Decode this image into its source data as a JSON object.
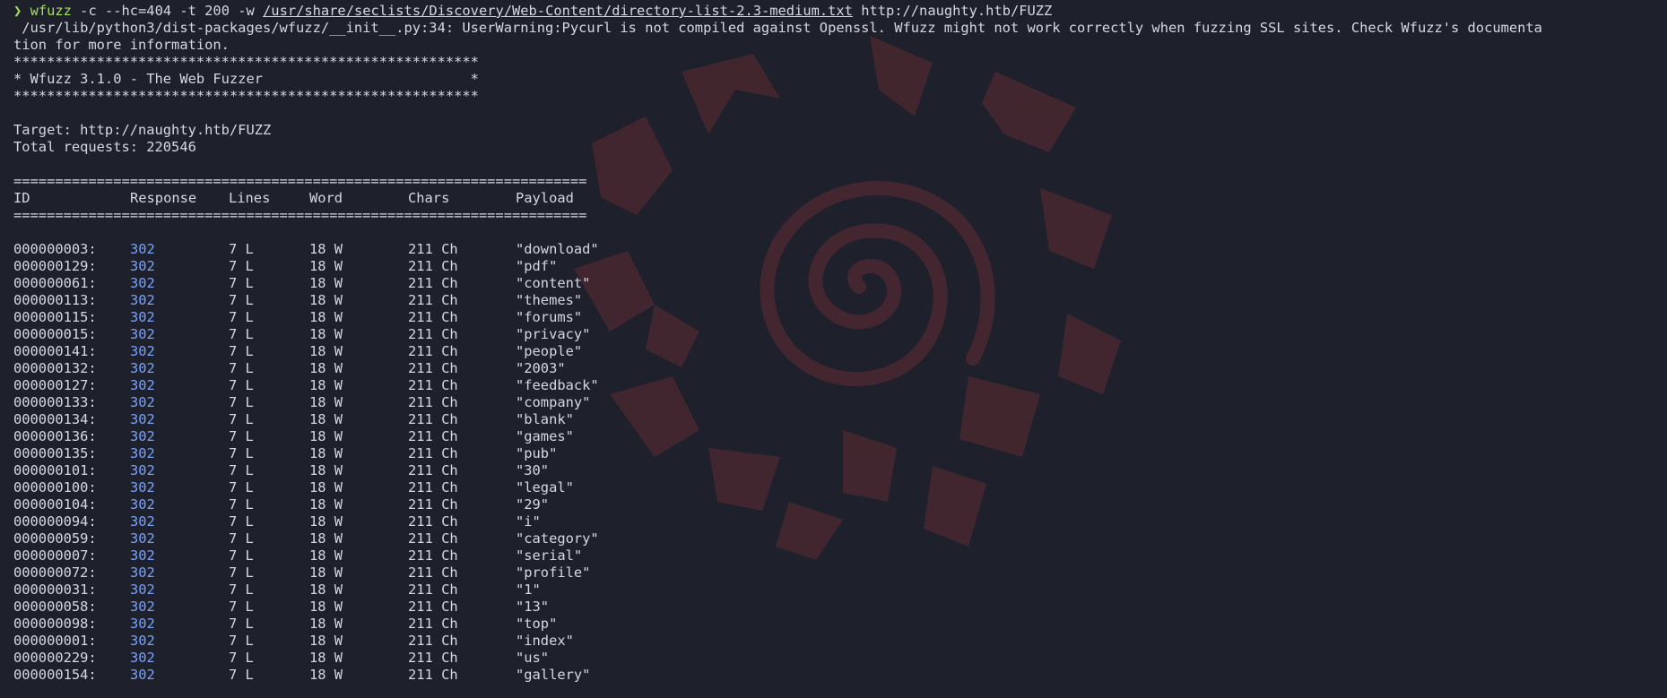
{
  "terminal": {
    "prompt_symbol": "❯",
    "command_name": "wfuzz",
    "command_args": " -c --hc=404 -t 200 -w ",
    "wordlist_path": "/usr/share/seclists/Discovery/Web-Content/directory-list-2.3-medium.txt",
    "command_url": " http://naughty.htb/FUZZ",
    "warning_line1": " /usr/lib/python3/dist-packages/wfuzz/__init__.py:34: UserWarning:Pycurl is not compiled against Openssl. Wfuzz might not work correctly when fuzzing SSL sites. Check Wfuzz's documenta",
    "warning_line2": "tion for more information.",
    "stars_line": "********************************************************",
    "banner_line": "* Wfuzz 3.1.0 - The Web Fuzzer                         *",
    "target_line": "Target: http://naughty.htb/FUZZ",
    "total_line": "Total requests: 220546",
    "separator": "=====================================================================",
    "headers": {
      "id": "ID",
      "response": "Response",
      "lines": "Lines",
      "word": "Word",
      "chars": "Chars",
      "payload": "Payload"
    },
    "colors": {
      "background": "#1e202c",
      "text": "#d6d8e1",
      "prompt": "#a3e05a",
      "status_code": "#7aa2f7",
      "watermark": "#4a2830"
    },
    "results": [
      {
        "id": "000000003:",
        "response": "302",
        "lines": "7 L",
        "word": "18 W",
        "chars": "211 Ch",
        "payload": "\"download\""
      },
      {
        "id": "000000129:",
        "response": "302",
        "lines": "7 L",
        "word": "18 W",
        "chars": "211 Ch",
        "payload": "\"pdf\""
      },
      {
        "id": "000000061:",
        "response": "302",
        "lines": "7 L",
        "word": "18 W",
        "chars": "211 Ch",
        "payload": "\"content\""
      },
      {
        "id": "000000113:",
        "response": "302",
        "lines": "7 L",
        "word": "18 W",
        "chars": "211 Ch",
        "payload": "\"themes\""
      },
      {
        "id": "000000115:",
        "response": "302",
        "lines": "7 L",
        "word": "18 W",
        "chars": "211 Ch",
        "payload": "\"forums\""
      },
      {
        "id": "000000015:",
        "response": "302",
        "lines": "7 L",
        "word": "18 W",
        "chars": "211 Ch",
        "payload": "\"privacy\""
      },
      {
        "id": "000000141:",
        "response": "302",
        "lines": "7 L",
        "word": "18 W",
        "chars": "211 Ch",
        "payload": "\"people\""
      },
      {
        "id": "000000132:",
        "response": "302",
        "lines": "7 L",
        "word": "18 W",
        "chars": "211 Ch",
        "payload": "\"2003\""
      },
      {
        "id": "000000127:",
        "response": "302",
        "lines": "7 L",
        "word": "18 W",
        "chars": "211 Ch",
        "payload": "\"feedback\""
      },
      {
        "id": "000000133:",
        "response": "302",
        "lines": "7 L",
        "word": "18 W",
        "chars": "211 Ch",
        "payload": "\"company\""
      },
      {
        "id": "000000134:",
        "response": "302",
        "lines": "7 L",
        "word": "18 W",
        "chars": "211 Ch",
        "payload": "\"blank\""
      },
      {
        "id": "000000136:",
        "response": "302",
        "lines": "7 L",
        "word": "18 W",
        "chars": "211 Ch",
        "payload": "\"games\""
      },
      {
        "id": "000000135:",
        "response": "302",
        "lines": "7 L",
        "word": "18 W",
        "chars": "211 Ch",
        "payload": "\"pub\""
      },
      {
        "id": "000000101:",
        "response": "302",
        "lines": "7 L",
        "word": "18 W",
        "chars": "211 Ch",
        "payload": "\"30\""
      },
      {
        "id": "000000100:",
        "response": "302",
        "lines": "7 L",
        "word": "18 W",
        "chars": "211 Ch",
        "payload": "\"legal\""
      },
      {
        "id": "000000104:",
        "response": "302",
        "lines": "7 L",
        "word": "18 W",
        "chars": "211 Ch",
        "payload": "\"29\""
      },
      {
        "id": "000000094:",
        "response": "302",
        "lines": "7 L",
        "word": "18 W",
        "chars": "211 Ch",
        "payload": "\"i\""
      },
      {
        "id": "000000059:",
        "response": "302",
        "lines": "7 L",
        "word": "18 W",
        "chars": "211 Ch",
        "payload": "\"category\""
      },
      {
        "id": "000000007:",
        "response": "302",
        "lines": "7 L",
        "word": "18 W",
        "chars": "211 Ch",
        "payload": "\"serial\""
      },
      {
        "id": "000000072:",
        "response": "302",
        "lines": "7 L",
        "word": "18 W",
        "chars": "211 Ch",
        "payload": "\"profile\""
      },
      {
        "id": "000000031:",
        "response": "302",
        "lines": "7 L",
        "word": "18 W",
        "chars": "211 Ch",
        "payload": "\"1\""
      },
      {
        "id": "000000058:",
        "response": "302",
        "lines": "7 L",
        "word": "18 W",
        "chars": "211 Ch",
        "payload": "\"13\""
      },
      {
        "id": "000000098:",
        "response": "302",
        "lines": "7 L",
        "word": "18 W",
        "chars": "211 Ch",
        "payload": "\"top\""
      },
      {
        "id": "000000001:",
        "response": "302",
        "lines": "7 L",
        "word": "18 W",
        "chars": "211 Ch",
        "payload": "\"index\""
      },
      {
        "id": "000000229:",
        "response": "302",
        "lines": "7 L",
        "word": "18 W",
        "chars": "211 Ch",
        "payload": "\"us\""
      },
      {
        "id": "000000154:",
        "response": "302",
        "lines": "7 L",
        "word": "18 W",
        "chars": "211 Ch",
        "payload": "\"gallery\""
      }
    ]
  }
}
